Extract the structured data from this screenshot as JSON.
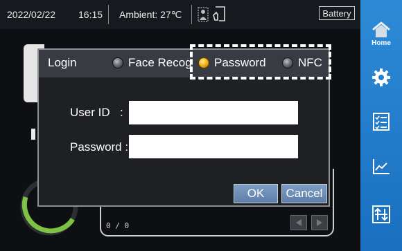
{
  "status_bar": {
    "date": "2022/02/22",
    "time": "16:15",
    "ambient": "Ambient: 27℃",
    "battery": "Battery"
  },
  "sidebar": {
    "items": [
      {
        "name": "home",
        "label": "Home",
        "icon": "home-icon",
        "active": true
      },
      {
        "name": "settings",
        "label": "",
        "icon": "gear-icon"
      },
      {
        "name": "list",
        "label": "",
        "icon": "checklist-icon"
      },
      {
        "name": "chart",
        "label": "",
        "icon": "line-chart-icon"
      },
      {
        "name": "sort",
        "label": "",
        "icon": "sort-icon"
      }
    ]
  },
  "main": {
    "count": "0 / 0"
  },
  "login": {
    "title": "Login",
    "methods": [
      {
        "label": "Face Recog",
        "selected": false
      },
      {
        "label": "Password",
        "selected": true
      },
      {
        "label": "NFC",
        "selected": false
      }
    ],
    "user_id_label": "User ID",
    "user_id_colon": ":",
    "user_id_value": "",
    "password_label": "Password :",
    "password_value": "",
    "ok_label": "OK",
    "cancel_label": "Cancel"
  },
  "colors": {
    "sidebar": "#2280cf",
    "selected_radio": "#f5b318",
    "button": "#6a8bb3",
    "gauge": "#7dc242"
  }
}
